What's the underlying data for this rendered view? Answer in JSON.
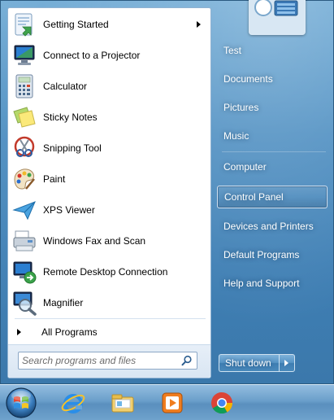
{
  "start_menu": {
    "programs": [
      {
        "label": "Getting Started",
        "icon": "getting-started-icon",
        "has_submenu": true
      },
      {
        "label": "Connect to a Projector",
        "icon": "projector-icon"
      },
      {
        "label": "Calculator",
        "icon": "calculator-icon"
      },
      {
        "label": "Sticky Notes",
        "icon": "sticky-notes-icon"
      },
      {
        "label": "Snipping Tool",
        "icon": "snipping-tool-icon"
      },
      {
        "label": "Paint",
        "icon": "paint-icon"
      },
      {
        "label": "XPS Viewer",
        "icon": "xps-viewer-icon"
      },
      {
        "label": "Windows Fax and Scan",
        "icon": "fax-scan-icon"
      },
      {
        "label": "Remote Desktop Connection",
        "icon": "remote-desktop-icon"
      },
      {
        "label": "Magnifier",
        "icon": "magnifier-icon"
      }
    ],
    "all_programs_label": "All Programs",
    "search": {
      "placeholder": "Search programs and files",
      "value": ""
    },
    "right_items": [
      {
        "label": "Test"
      },
      {
        "label": "Documents"
      },
      {
        "label": "Pictures"
      },
      {
        "label": "Music"
      },
      {
        "label": "Computer"
      },
      {
        "label": "Control Panel",
        "highlighted": true
      },
      {
        "label": "Devices and Printers"
      },
      {
        "label": "Default Programs"
      },
      {
        "label": "Help and Support"
      }
    ],
    "shutdown_label": "Shut down"
  },
  "taskbar": {
    "buttons": [
      {
        "name": "internet-explorer-icon"
      },
      {
        "name": "windows-explorer-icon"
      },
      {
        "name": "media-player-icon"
      },
      {
        "name": "chrome-icon"
      }
    ]
  },
  "colors": {
    "menu_background": "#4a8cc0",
    "taskbar": "#6b9fca",
    "highlight_border": "#e6f0fa",
    "left_panel": "#ffffff",
    "right_text": "#ffffff"
  }
}
